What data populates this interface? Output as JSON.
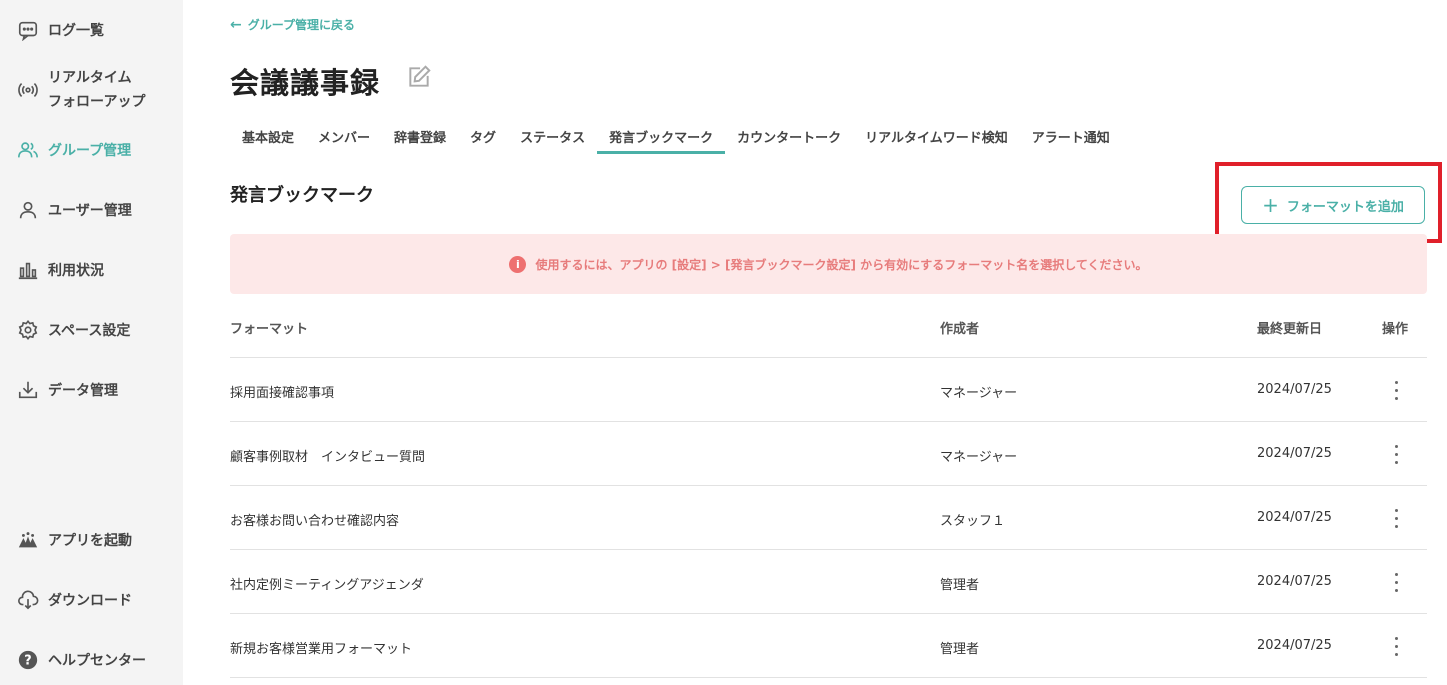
{
  "sidebar": {
    "items": [
      {
        "label": "ログ一覧",
        "icon": "chat-bubble-icon"
      },
      {
        "label_line1": "リアルタイム",
        "label_line2": "フォローアップ",
        "icon": "radio-broadcast-icon"
      },
      {
        "label": "グループ管理",
        "icon": "group-icon"
      },
      {
        "label": "ユーザー管理",
        "icon": "user-icon"
      },
      {
        "label": "利用状況",
        "icon": "bar-chart-icon"
      },
      {
        "label": "スペース設定",
        "icon": "gear-icon"
      },
      {
        "label": "データ管理",
        "icon": "download-icon"
      }
    ],
    "bottom_items": [
      {
        "label": "アプリを起動",
        "icon": "app-launch-icon"
      },
      {
        "label": "ダウンロード",
        "icon": "cloud-download-icon"
      },
      {
        "label": "ヘルプセンター",
        "icon": "help-icon"
      }
    ]
  },
  "header": {
    "back_label": "グループ管理に戻る",
    "title": "会議議事録"
  },
  "tabs": [
    {
      "label": "基本設定"
    },
    {
      "label": "メンバー"
    },
    {
      "label": "辞書登録"
    },
    {
      "label": "タグ"
    },
    {
      "label": "ステータス"
    },
    {
      "label": "発言ブックマーク"
    },
    {
      "label": "カウンタートーク"
    },
    {
      "label": "リアルタイムワード検知"
    },
    {
      "label": "アラート通知"
    }
  ],
  "active_tab": "発言ブックマーク",
  "section": {
    "title": "発言ブックマーク",
    "add_button": "フォーマットを追加"
  },
  "alert": {
    "text": "使用するには、アプリの [設定] > [発言ブックマーク設定] から有効にするフォーマット名を選択してください。"
  },
  "table": {
    "headers": {
      "format": "フォーマット",
      "creator": "作成者",
      "updated": "最終更新日",
      "action": "操作"
    },
    "rows": [
      {
        "format": "採用面接確認事項",
        "creator": "マネージャー",
        "updated": "2024/07/25"
      },
      {
        "format": "顧客事例取材　インタビュー質問",
        "creator": "マネージャー",
        "updated": "2024/07/25"
      },
      {
        "format": "お客様お問い合わせ確認内容",
        "creator": "スタッフ１",
        "updated": "2024/07/25"
      },
      {
        "format": "社内定例ミーティングアジェンダ",
        "creator": "管理者",
        "updated": "2024/07/25"
      },
      {
        "format": "新規お客様営業用フォーマット",
        "creator": "管理者",
        "updated": "2024/07/25"
      }
    ]
  },
  "colors": {
    "accent": "#4ab0a7",
    "alert_bg": "#fde8e8",
    "alert_text": "#e77c7c",
    "highlight": "#e0202a"
  }
}
